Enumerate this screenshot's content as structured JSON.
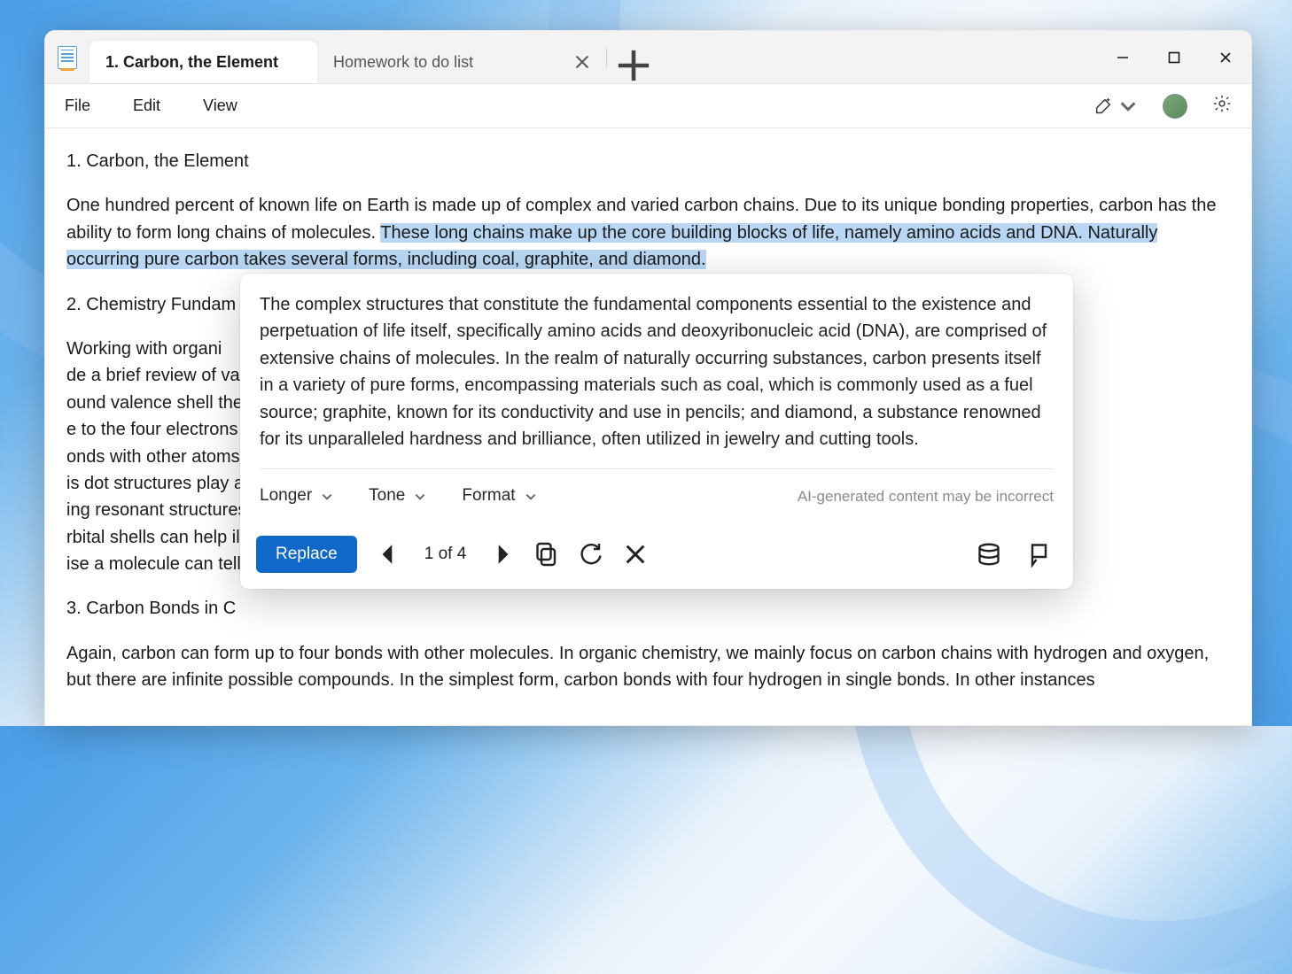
{
  "tabs": {
    "active": "1. Carbon, the Element",
    "inactive": "Homework to do list"
  },
  "menu": {
    "file": "File",
    "edit": "Edit",
    "view": "View"
  },
  "doc": {
    "h1": "1. Carbon, the Element",
    "p1a": "One hundred percent of known life on Earth is made up of complex and varied carbon chains. Due to its unique bonding properties, carbon has the ability to form long chains of molecules. ",
    "p1b": "These long chains make up the core building blocks of life, namely amino acids and DNA. Naturally occurring pure carbon takes several forms, including coal, graphite, and diamond.",
    "h2": "2. Chemistry Fundam",
    "p2": "Working with organi                                                                                                                                                                                                                                                         de a brief review of valence shell theory,                                                                                                                                                                                                                                             ound valence shell theory—the idea tha                                                                                                                                                                                                                                                  e to the four electrons in its outer                                                                                                                                                                                                                                                      onds with other atoms or molecules.                                                                                                                                                                                                                                                      is dot structures play a pivotal role in                                                                                                                                                                                                                                                    ing resonant structures) can help                                                                                                                                                                                                                                                       rbital shells can help illuminate the event                                                                                                                                                                                                                                                   ise a molecule can tell us its basic shap",
    "h3": "3. Carbon Bonds in C",
    "p3": "Again, carbon can form up to four bonds with other molecules. In organic chemistry, we mainly focus on carbon chains with hydrogen and oxygen, but there are infinite possible compounds. In the simplest form, carbon bonds with four hydrogen in single bonds. In other instances"
  },
  "rewrite": {
    "text": "The complex structures that constitute the fundamental components essential to the existence and perpetuation of life itself, specifically amino acids and deoxyribonucleic acid (DNA), are comprised of extensive chains of molecules. In the realm of naturally occurring substances, carbon presents itself in a variety of pure forms, encompassing materials such as coal, which is commonly used as a fuel source; graphite, known for its conductivity and use in pencils; and diamond, a substance renowned for its unparalleled hardness and brilliance, often utilized in jewelry and cutting tools.",
    "options": {
      "longer": "Longer",
      "tone": "Tone",
      "format": "Format"
    },
    "disclaimer": "AI-generated content may be incorrect",
    "replace": "Replace",
    "counter": "1 of 4"
  }
}
